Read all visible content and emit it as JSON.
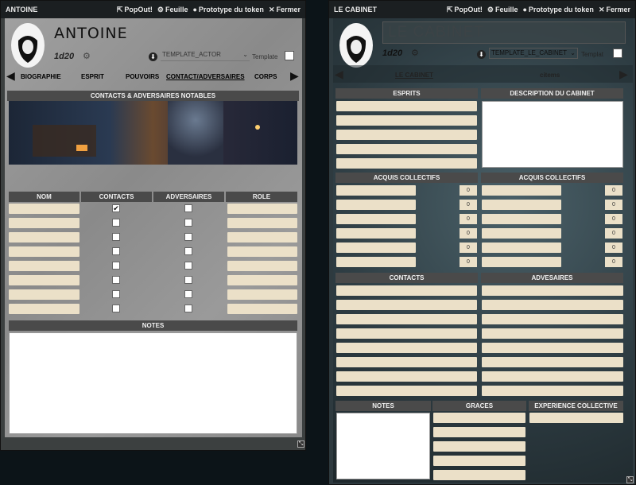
{
  "window_a": {
    "title": "ANTOINE",
    "btn_popout": "PopOut!",
    "btn_feuille": "Feuille",
    "btn_prototype": "Prototype du token",
    "btn_fermer": "Fermer",
    "name": "ANTOINE",
    "dice": "1d20",
    "template_select": "TEMPLATE_ACTOR",
    "template_label": "Template",
    "tabs": [
      "BIOGRAPHIE",
      "ESPRIT",
      "POUVOIRS",
      "CONTACT/ADVERSAIRES",
      "CORPS"
    ],
    "section_contacts": "CONTACTS & ADVERSAIRES NOTABLES",
    "col_nom": "NOM",
    "col_contacts": "CONTACTS",
    "col_adversaires": "ADVERSAIRES",
    "col_role": "ROLE",
    "notes": "NOTES",
    "contacts_checked": [
      true,
      false,
      false,
      false,
      false,
      false,
      false,
      false
    ]
  },
  "window_b": {
    "title": "LE CABINET",
    "btn_popout": "PopOut!",
    "btn_feuille": "Feuille",
    "btn_prototype": "Prototype du token",
    "btn_fermer": "Fermer",
    "name": "LE CABINET",
    "dice": "1d20",
    "template_select": "TEMPLATE_LE_CABINET",
    "template_label": "Templat",
    "tab_cabinet": "LE CABINET",
    "tab_citems": "citems",
    "section_esprits": "ESPRITS",
    "section_description": "DESCRIPTION DU CABINET",
    "section_acquis1": "ACQUIS COLLECTIFS",
    "section_acquis2": "ACQUIS COLLECTIFS",
    "section_contacts": "CONTACTS",
    "section_adversaires": "ADVESAIRES",
    "section_notes": "NOTES",
    "section_graces": "GRACES",
    "section_experience": "EXPERIENCE COLLECTIVE",
    "acquis_values_left": [
      "0",
      "0",
      "0",
      "0",
      "0",
      "0"
    ],
    "acquis_values_right": [
      "0",
      "0",
      "0",
      "0",
      "0",
      "0"
    ]
  },
  "colors": {
    "field": "#ebe0c8",
    "section": "#4a4a4a"
  }
}
